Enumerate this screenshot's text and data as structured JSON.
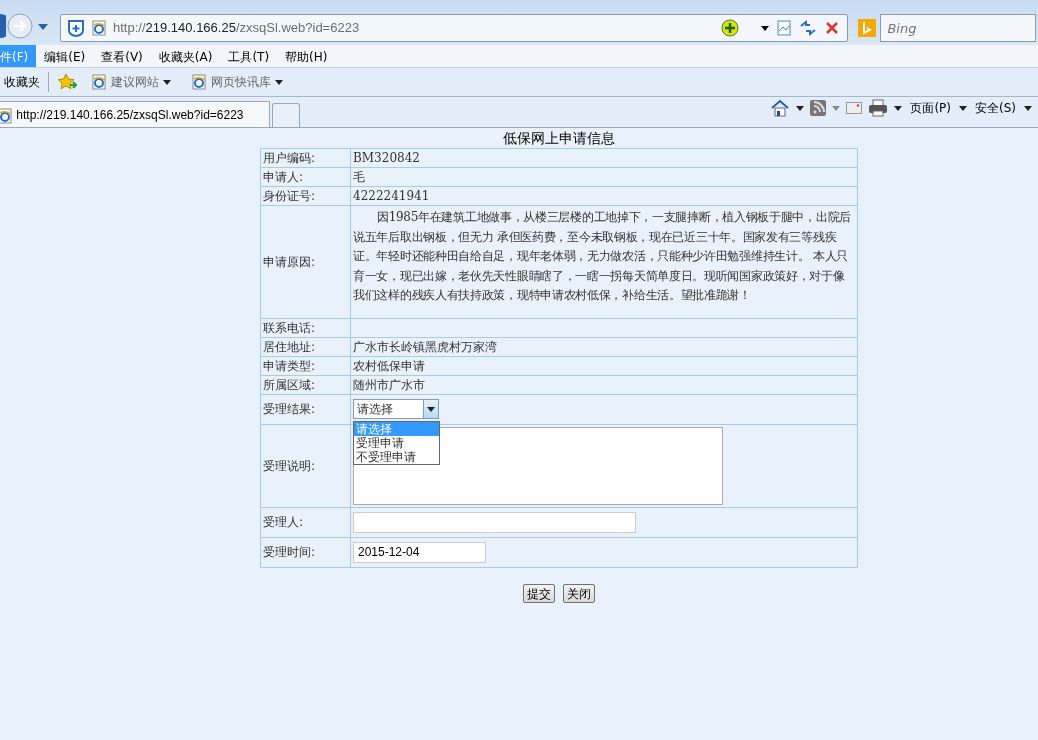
{
  "browser": {
    "address": "http://219.140.166.25/zxsqSl.web?id=6223",
    "search_placeholder": "Bing",
    "menu": [
      {
        "label": "件(F)",
        "selected": true
      },
      {
        "label": "编辑(E)",
        "selected": false
      },
      {
        "label": "查看(V)",
        "selected": false
      },
      {
        "label": "收藏夹(A)",
        "selected": false
      },
      {
        "label": "工具(T)",
        "selected": false
      },
      {
        "label": "帮助(H)",
        "selected": false
      }
    ],
    "favorites": {
      "label": "收藏夹",
      "links": [
        "建议网站",
        "网页快讯库"
      ]
    },
    "tab": {
      "title": "http://219.140.166.25/zxsqSl.web?id=6223"
    },
    "commands": [
      "页面(P)",
      "安全(S)"
    ]
  },
  "form": {
    "title": "低保网上申请信息",
    "info_rows": [
      {
        "label": "用户编码:",
        "value": "BM320842"
      },
      {
        "label": "申请人:",
        "value": "毛"
      },
      {
        "label": "身份证号:",
        "value": "4222241941"
      }
    ],
    "reason": {
      "label": "申请原因:",
      "text": "因1985年在建筑工地做事，从楼三层楼的工地掉下，一支腿摔断，植入钢板于腿中，出院后说五年后取出钢板，但无力 承但医药费，至今未取钢板，现在已近三十年。国家发有三等残疾证。年轻时还能种田自给自足，现年老体弱，无力做农活，只能种少许田勉强维持生计。 本人只育一女，现已出嫁，老伙先天性眼睛瞎了，一瞎一拐每天简单度日。现听闻国家政策好，对于像我们这样的残疾人有扶持政策，现特申请农村低保，补给生活。望批准跪谢！"
    },
    "detail_rows": [
      {
        "label": "联系电话:",
        "value": ""
      },
      {
        "label": "居住地址:",
        "value": "广水市长岭镇黑虎村万家湾"
      },
      {
        "label": "申请类型:",
        "value": "农村低保申请"
      },
      {
        "label": "所属区域:",
        "value": "随州市广水市"
      }
    ],
    "result": {
      "label": "受理结果:",
      "value": "请选择",
      "expanded": true,
      "options": [
        {
          "label": "请选择",
          "selected": true
        },
        {
          "label": "受理申请",
          "selected": false
        },
        {
          "label": "不受理申请",
          "selected": false
        }
      ]
    },
    "description": {
      "label": "受理说明:"
    },
    "handler": {
      "label": "受理人:"
    },
    "time": {
      "label": "受理时间:",
      "value": "2015-12-04"
    },
    "buttons": [
      "提交",
      "关闭"
    ]
  }
}
